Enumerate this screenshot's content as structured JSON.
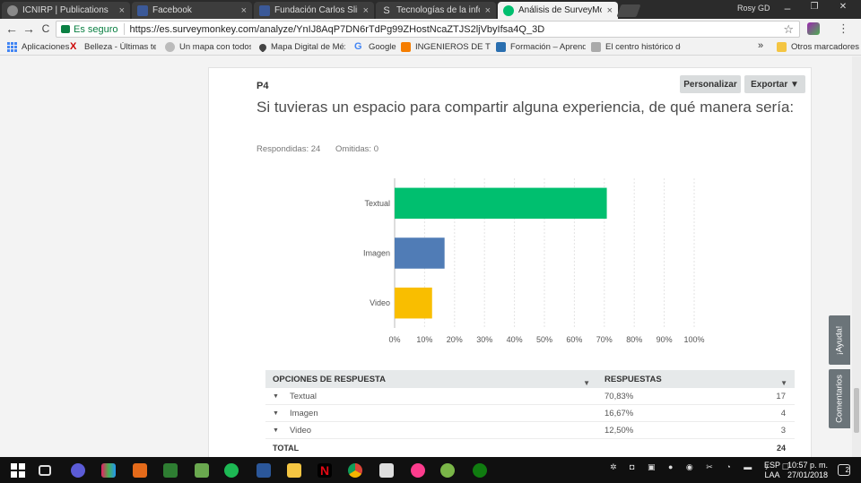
{
  "browser": {
    "tabs": [
      {
        "title": "ICNIRP | Publications",
        "color": "#777777"
      },
      {
        "title": "Facebook",
        "color": "#3b5998"
      },
      {
        "title": "Fundación Carlos Slim Sa",
        "color": "#3b5998"
      },
      {
        "title": "Tecnologías de la inform",
        "color": "#3d3d3d"
      },
      {
        "title": "Análisis de SurveyMonke",
        "color": "#00bf6f"
      }
    ],
    "close_glyph": "×",
    "user_name": "Rosy GD",
    "window_controls": {
      "minimize": "–",
      "maximize": "❐",
      "close": "✕"
    },
    "nav": {
      "back": "←",
      "forward": "→",
      "reload": "C"
    },
    "secure_label": "Es seguro",
    "url": "https://es.surveymonkey.com/analyze/YnIJ8AqP7DN6rTdPg99ZHostNcaZTJS2ljVbyIfsa4Q_3D",
    "star_glyph": "☆",
    "menu_glyph": "⋮"
  },
  "bookmarks": [
    {
      "label": "Aplicaciones",
      "icon": "apps-grid-icon"
    },
    {
      "label": "Belleza - Últimas tenc",
      "icon": "x-icon"
    },
    {
      "label": "Un mapa con todos l",
      "icon": "globe-icon"
    },
    {
      "label": "Mapa Digital de Méx",
      "icon": "map-pin-icon"
    },
    {
      "label": "Google",
      "icon": "google-icon"
    },
    {
      "label": "INGENIEROS DE TELE",
      "icon": "blogger-icon"
    },
    {
      "label": "Formación – Aprende",
      "icon": "monitor-icon"
    },
    {
      "label": "El centro histórico de",
      "icon": "page-icon"
    }
  ],
  "bookmarks_more": "»",
  "other_bookmarks": "Otros marcadores",
  "question": {
    "number": "P4",
    "title": "Si tuvieras un espacio para compartir alguna experiencia, de qué manera sería:",
    "answered": "Respondidas: 24",
    "skipped": "Omitidas: 0"
  },
  "buttons": {
    "customize": "Personalizar",
    "export": "Exportar ▼"
  },
  "chart_data": {
    "type": "bar",
    "orientation": "horizontal",
    "categories": [
      "Textual",
      "Imagen",
      "Video"
    ],
    "values": [
      70.83,
      16.67,
      12.5
    ],
    "colors": [
      "#00bf6f",
      "#507cb6",
      "#f9be00"
    ],
    "xlim": [
      0,
      100
    ],
    "ticks": [
      "0%",
      "10%",
      "20%",
      "30%",
      "40%",
      "50%",
      "60%",
      "70%",
      "80%",
      "90%",
      "100%"
    ],
    "grid": true
  },
  "table": {
    "headers": {
      "options": "OPCIONES DE RESPUESTA",
      "responses": "RESPUESTAS"
    },
    "header_caret": "▼",
    "row_caret": "▼",
    "rows": [
      {
        "option": "Textual",
        "percent": "70,83%",
        "count": "17"
      },
      {
        "option": "Imagen",
        "percent": "16,67%",
        "count": "4"
      },
      {
        "option": "Video",
        "percent": "12,50%",
        "count": "3"
      }
    ],
    "total_label": "TOTAL",
    "total_count": "24"
  },
  "sidebar_tabs": {
    "help": "¡Ayuda!",
    "comments": "Comentarios"
  },
  "taskbar": {
    "language": "ESP",
    "layout": "LAA",
    "time": "10:57 p. m.",
    "date": "27/01/2018",
    "notifications": "2"
  }
}
